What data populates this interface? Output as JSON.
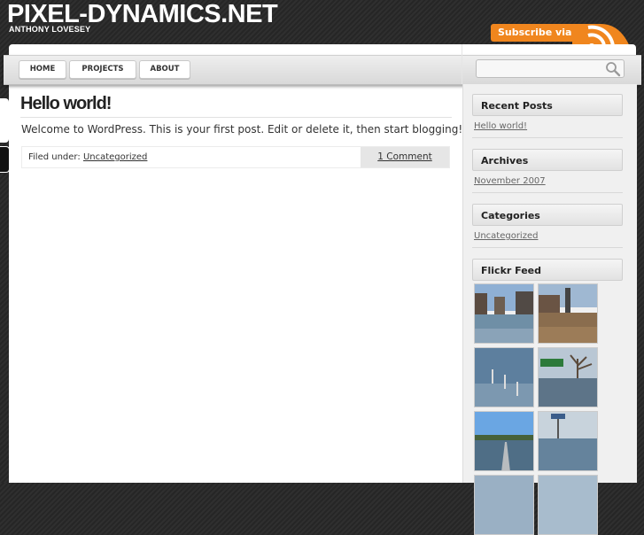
{
  "header": {
    "site_title": "PIXEL-DYNAMICS.NET",
    "site_subtitle": "ANTHONY LOVESEY",
    "rss_label": "Subscribe via RSS",
    "rss_icon": "rss-feed-icon"
  },
  "nav": {
    "items": [
      {
        "label": "HOME"
      },
      {
        "label": "PROJECTS"
      },
      {
        "label": "ABOUT"
      }
    ],
    "search": {
      "value": "",
      "placeholder": "",
      "icon": "search-icon"
    }
  },
  "post": {
    "title": "Hello world!",
    "body": "Welcome to WordPress. This is your first post. Edit or delete it, then start blogging!",
    "filed_under_label": "Filed under:",
    "category": "Uncategorized",
    "comments": "1 Comment"
  },
  "sidebar": {
    "recent_posts": {
      "title": "Recent Posts",
      "items": [
        "Hello world!"
      ]
    },
    "archives": {
      "title": "Archives",
      "items": [
        "November 2007"
      ]
    },
    "categories": {
      "title": "Categories",
      "items": [
        "Uncategorized"
      ]
    },
    "flickr": {
      "title": "Flickr Feed",
      "photo_count": 8
    }
  },
  "colors": {
    "background": "#2b2b2b",
    "rss_orange": "#f0861e",
    "page_bg": "#ffffff",
    "sidebar_bg": "#f0f0f0"
  }
}
